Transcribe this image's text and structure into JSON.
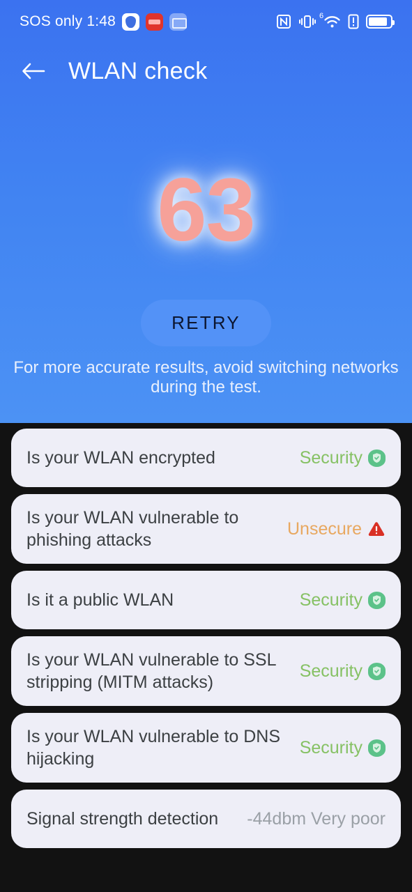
{
  "statusbar": {
    "carrier_time": "SOS only 1:48",
    "left_icons": [
      "shield-app-icon",
      "red-app-icon",
      "mail-app-icon"
    ],
    "right_icons": [
      "nfc-icon",
      "vibrate-icon",
      "wifi-6-icon",
      "alert-icon",
      "battery-icon"
    ],
    "wifi_generation": "6"
  },
  "appbar": {
    "back_icon": "back-arrow-icon",
    "title": "WLAN check"
  },
  "hero": {
    "score": "63",
    "score_color": "#f6a199",
    "retry_label": "RETRY",
    "hint": "For more accurate results, avoid switching networks during the test.",
    "bg_top_color": "#3b72f0",
    "bg_bottom_color": "#4c92f4"
  },
  "colors": {
    "secure_green": "#86c164",
    "unsecure_orange": "#e8a860",
    "neutral_gray": "#9aa0a6",
    "card_bg": "#eeeef7",
    "page_bg": "#121212"
  },
  "checks": [
    {
      "label": "Is your WLAN encrypted",
      "status": "Security",
      "status_kind": "secure",
      "icon": "shield-check-icon"
    },
    {
      "label": "Is your WLAN vulnerable to phishing attacks",
      "status": "Unsecure",
      "status_kind": "unsecure",
      "icon": "warning-triangle-icon"
    },
    {
      "label": "Is it a public WLAN",
      "status": "Security",
      "status_kind": "secure",
      "icon": "shield-check-icon"
    },
    {
      "label": "Is your WLAN vulnerable to SSL stripping (MITM attacks)",
      "status": "Security",
      "status_kind": "secure",
      "icon": "shield-check-icon"
    },
    {
      "label": "Is your WLAN vulnerable to DNS hijacking",
      "status": "Security",
      "status_kind": "secure",
      "icon": "shield-check-icon"
    },
    {
      "label": "Signal strength detection",
      "status": "-44dbm Very poor",
      "status_kind": "plain",
      "icon": "none"
    }
  ]
}
